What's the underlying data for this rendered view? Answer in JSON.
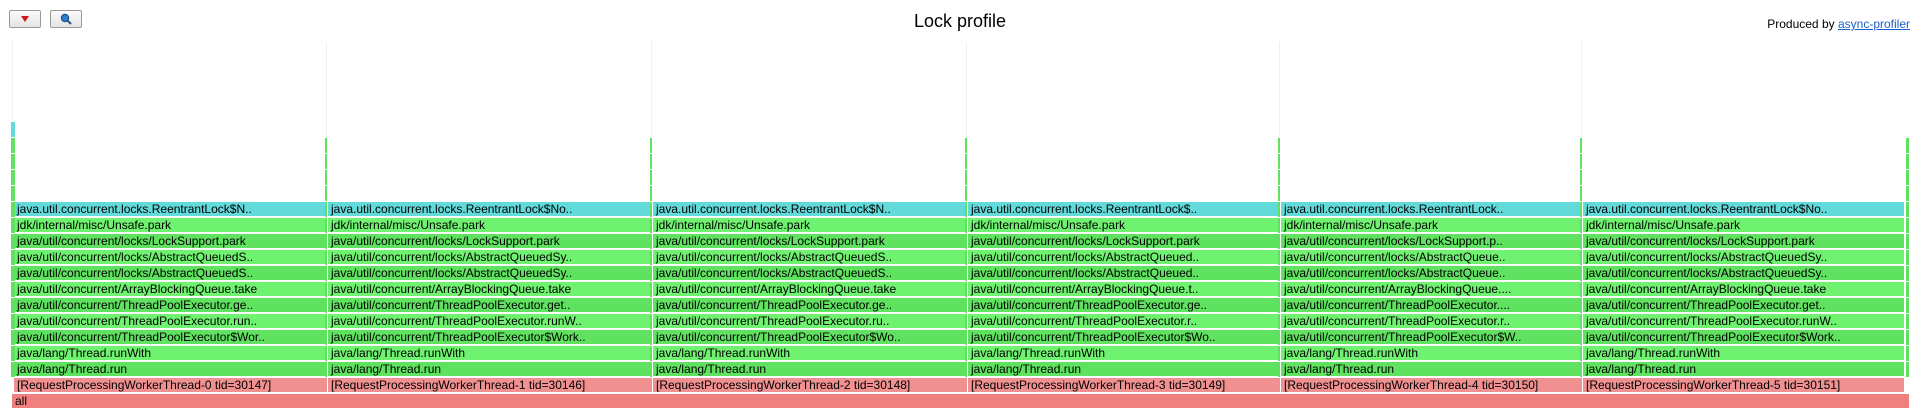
{
  "header": {
    "title": "Lock profile",
    "produced_by": "Produced by",
    "profiler_link": "async-profiler"
  },
  "toolbar": {
    "reverse_icon": "red-triangle-down-icon",
    "search_icon": "magnifier-icon"
  },
  "colors": {
    "root": "#f08080",
    "thread": "#f09090",
    "java": "#5fe25f",
    "java_light": "#6ff26f",
    "lock_class": "#62dada",
    "accent_link": "#1a5fcc"
  },
  "flamegraph": {
    "root_label": "all",
    "threads": [
      {
        "thread": "[RequestProcessingWorkerThread-0 tid=30147]",
        "frames": [
          "java/lang/Thread.run",
          "java/lang/Thread.runWith",
          "java/util/concurrent/ThreadPoolExecutor$Wor..",
          "java/util/concurrent/ThreadPoolExecutor.run..",
          "java/util/concurrent/ThreadPoolExecutor.ge..",
          "java/util/concurrent/ArrayBlockingQueue.take",
          "java/util/concurrent/locks/AbstractQueuedS..",
          "java/util/concurrent/locks/AbstractQueuedS..",
          "java/util/concurrent/locks/LockSupport.park",
          "jdk/internal/misc/Unsafe.park",
          "java.util.concurrent.locks.ReentrantLock$N.."
        ]
      },
      {
        "thread": "[RequestProcessingWorkerThread-1 tid=30146]",
        "frames": [
          "java/lang/Thread.run",
          "java/lang/Thread.runWith",
          "java/util/concurrent/ThreadPoolExecutor$Work..",
          "java/util/concurrent/ThreadPoolExecutor.runW..",
          "java/util/concurrent/ThreadPoolExecutor.get..",
          "java/util/concurrent/ArrayBlockingQueue.take",
          "java/util/concurrent/locks/AbstractQueuedSy..",
          "java/util/concurrent/locks/AbstractQueuedSy..",
          "java/util/concurrent/locks/LockSupport.park",
          "jdk/internal/misc/Unsafe.park",
          "java.util.concurrent.locks.ReentrantLock$No.."
        ]
      },
      {
        "thread": "[RequestProcessingWorkerThread-2 tid=30148]",
        "frames": [
          "java/lang/Thread.run",
          "java/lang/Thread.runWith",
          "java/util/concurrent/ThreadPoolExecutor$Wo..",
          "java/util/concurrent/ThreadPoolExecutor.ru..",
          "java/util/concurrent/ThreadPoolExecutor.ge..",
          "java/util/concurrent/ArrayBlockingQueue.take",
          "java/util/concurrent/locks/AbstractQueuedS..",
          "java/util/concurrent/locks/AbstractQueuedS..",
          "java/util/concurrent/locks/LockSupport.park",
          "jdk/internal/misc/Unsafe.park",
          "java.util.concurrent.locks.ReentrantLock$N.."
        ]
      },
      {
        "thread": "[RequestProcessingWorkerThread-3 tid=30149]",
        "frames": [
          "java/lang/Thread.run",
          "java/lang/Thread.runWith",
          "java/util/concurrent/ThreadPoolExecutor$Wo..",
          "java/util/concurrent/ThreadPoolExecutor.r..",
          "java/util/concurrent/ThreadPoolExecutor.ge..",
          "java/util/concurrent/ArrayBlockingQueue.t..",
          "java/util/concurrent/locks/AbstractQueued..",
          "java/util/concurrent/locks/AbstractQueued..",
          "java/util/concurrent/locks/LockSupport.park",
          "jdk/internal/misc/Unsafe.park",
          "java.util.concurrent.locks.ReentrantLock$.."
        ]
      },
      {
        "thread": "[RequestProcessingWorkerThread-4 tid=30150]",
        "frames": [
          "java/lang/Thread.run",
          "java/lang/Thread.runWith",
          "java/util/concurrent/ThreadPoolExecutor$W..",
          "java/util/concurrent/ThreadPoolExecutor.r..",
          "java/util/concurrent/ThreadPoolExecutor....",
          "java/util/concurrent/ArrayBlockingQueue....",
          "java/util/concurrent/locks/AbstractQueue..",
          "java/util/concurrent/locks/AbstractQueue..",
          "java/util/concurrent/locks/LockSupport.p..",
          "jdk/internal/misc/Unsafe.park",
          "java.util.concurrent.locks.ReentrantLock.."
        ]
      },
      {
        "thread": "[RequestProcessingWorkerThread-5 tid=30151]",
        "frames": [
          "java/lang/Thread.run",
          "java/lang/Thread.runWith",
          "java/util/concurrent/ThreadPoolExecutor$Work..",
          "java/util/concurrent/ThreadPoolExecutor.runW..",
          "java/util/concurrent/ThreadPoolExecutor.get..",
          "java/util/concurrent/ArrayBlockingQueue.take",
          "java/util/concurrent/locks/AbstractQueuedSy..",
          "java/util/concurrent/locks/AbstractQueuedSy..",
          "java/util/concurrent/locks/LockSupport.park",
          "jdk/internal/misc/Unsafe.park",
          "java.util.concurrent.locks.ReentrantLock$No.."
        ]
      }
    ]
  }
}
